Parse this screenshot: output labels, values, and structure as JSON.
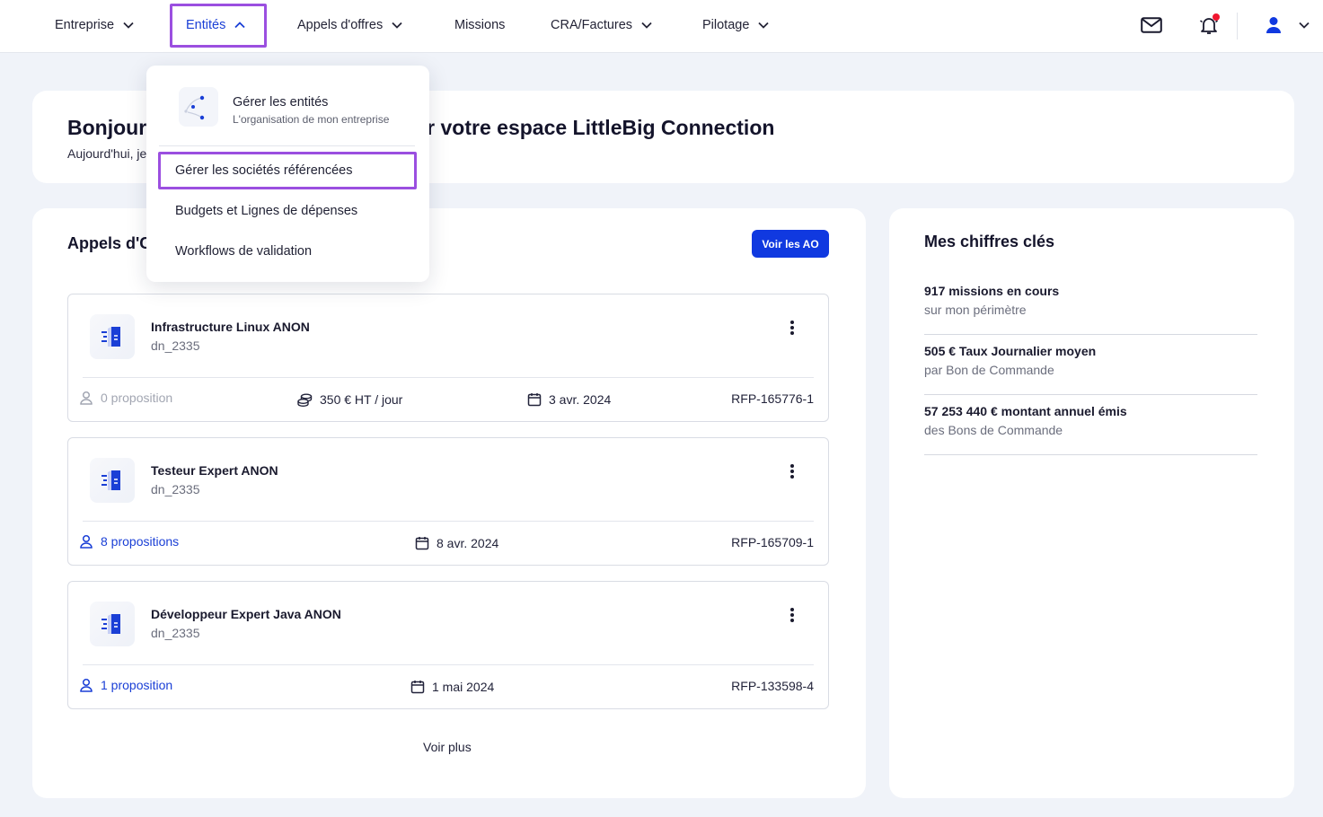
{
  "nav": {
    "items": [
      {
        "label": "Entreprise"
      },
      {
        "label": "Entités"
      },
      {
        "label": "Appels d'offres"
      },
      {
        "label": "Missions"
      },
      {
        "label": "CRA/Factures"
      },
      {
        "label": "Pilotage"
      }
    ]
  },
  "welcome": {
    "title_left": "Bonjour",
    "title_right": "e sur votre espace LittleBig Connection",
    "subtitle": "Aujourd'hui, je"
  },
  "dropdown": {
    "header_title": "Gérer les entités",
    "header_subtitle": "L'organisation de mon entreprise",
    "items": [
      {
        "label": "Gérer les sociétés référencées"
      },
      {
        "label": "Budgets et Lignes de dépenses"
      },
      {
        "label": "Workflows de validation"
      }
    ]
  },
  "ao": {
    "title": "Appels d'C",
    "button_label": "Voir les AO",
    "more_label": "Voir plus",
    "items": [
      {
        "name": "Infrastructure Linux ANON",
        "code": "dn_2335",
        "proposals": "0 proposition",
        "rate": "350 € HT / jour",
        "date": "3 avr. 2024",
        "ref": "RFP-165776-1"
      },
      {
        "name": "Testeur Expert ANON",
        "code": "dn_2335",
        "proposals": "8 propositions",
        "date": "8 avr. 2024",
        "ref": "RFP-165709-1"
      },
      {
        "name": "Développeur Expert Java ANON",
        "code": "dn_2335",
        "proposals": "1 proposition",
        "date": "1 mai 2024",
        "ref": "RFP-133598-4"
      }
    ]
  },
  "kpi": {
    "title": "Mes chiffres clés",
    "items": [
      {
        "value": "917 missions en cours",
        "label": "sur mon périmètre"
      },
      {
        "value": "505 € Taux Journalier moyen",
        "label": "par Bon de Commande"
      },
      {
        "value": "57 253 440 € montant annuel émis",
        "label": "des Bons de Commande"
      }
    ]
  },
  "colors": {
    "accent": "#1039e0",
    "highlight": "#9b4fe0",
    "notification": "#f0162f"
  }
}
